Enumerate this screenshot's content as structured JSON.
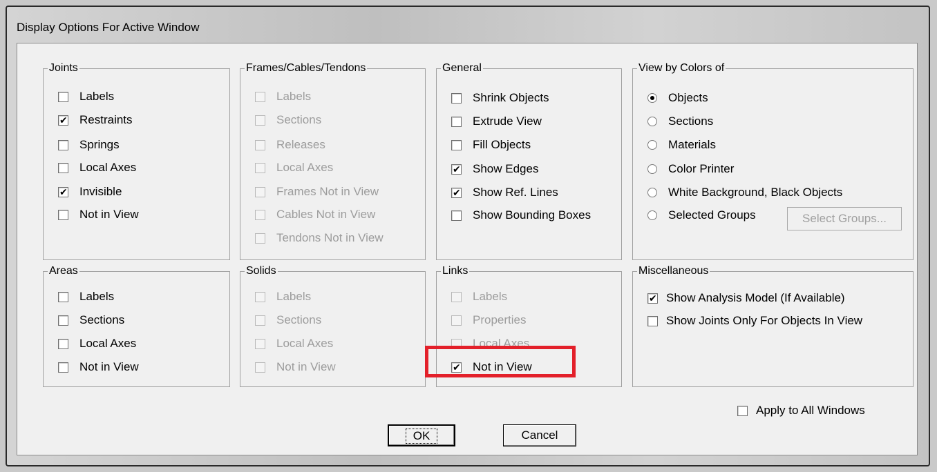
{
  "window": {
    "title": "Display Options For Active Window"
  },
  "groups": {
    "joints": {
      "title": "Joints",
      "items": [
        {
          "label": "Labels",
          "checked": false
        },
        {
          "label": "Restraints",
          "checked": true
        },
        {
          "label": "Springs",
          "checked": false
        },
        {
          "label": "Local Axes",
          "checked": false
        },
        {
          "label": "Invisible",
          "checked": true
        },
        {
          "label": "Not in View",
          "checked": false
        }
      ]
    },
    "frames": {
      "title": "Frames/Cables/Tendons",
      "items": [
        {
          "label": "Labels",
          "checked": false
        },
        {
          "label": "Sections",
          "checked": false
        },
        {
          "label": "Releases",
          "checked": false
        },
        {
          "label": "Local Axes",
          "checked": false
        },
        {
          "label": "Frames Not in View",
          "checked": false
        },
        {
          "label": "Cables Not in View",
          "checked": false
        },
        {
          "label": "Tendons Not in View",
          "checked": false
        }
      ]
    },
    "general": {
      "title": "General",
      "items": [
        {
          "label": "Shrink Objects",
          "checked": false
        },
        {
          "label": "Extrude View",
          "checked": false
        },
        {
          "label": "Fill Objects",
          "checked": false
        },
        {
          "label": "Show Edges",
          "checked": true
        },
        {
          "label": "Show Ref. Lines",
          "checked": true
        },
        {
          "label": "Show Bounding Boxes",
          "checked": false
        }
      ]
    },
    "colors": {
      "title": "View by Colors of",
      "items": [
        {
          "label": "Objects",
          "selected": true
        },
        {
          "label": "Sections",
          "selected": false
        },
        {
          "label": "Materials",
          "selected": false
        },
        {
          "label": "Color Printer",
          "selected": false
        },
        {
          "label": "White Background, Black Objects",
          "selected": false
        },
        {
          "label": "Selected Groups",
          "selected": false
        }
      ],
      "select_groups_label": "Select Groups..."
    },
    "areas": {
      "title": "Areas",
      "items": [
        {
          "label": "Labels",
          "checked": false
        },
        {
          "label": "Sections",
          "checked": false
        },
        {
          "label": "Local Axes",
          "checked": false
        },
        {
          "label": "Not in View",
          "checked": false
        }
      ]
    },
    "solids": {
      "title": "Solids",
      "items": [
        {
          "label": "Labels",
          "checked": false
        },
        {
          "label": "Sections",
          "checked": false
        },
        {
          "label": "Local Axes",
          "checked": false
        },
        {
          "label": "Not in View",
          "checked": false
        }
      ]
    },
    "links": {
      "title": "Links",
      "items": [
        {
          "label": "Labels",
          "checked": false
        },
        {
          "label": "Properties",
          "checked": false
        },
        {
          "label": "Local Axes",
          "checked": false
        },
        {
          "label": "Not in View",
          "checked": true
        }
      ]
    },
    "misc": {
      "title": "Miscellaneous",
      "items": [
        {
          "label": "Show Analysis Model  (If Available)",
          "checked": true
        },
        {
          "label": "Show Joints Only For Objects In View",
          "checked": false
        }
      ]
    }
  },
  "apply_all": {
    "label": "Apply to All Windows",
    "checked": false
  },
  "buttons": {
    "ok": "OK",
    "cancel": "Cancel"
  },
  "colors": {
    "highlight": "#e3202a",
    "disabled_text": "#9c9c9c"
  }
}
